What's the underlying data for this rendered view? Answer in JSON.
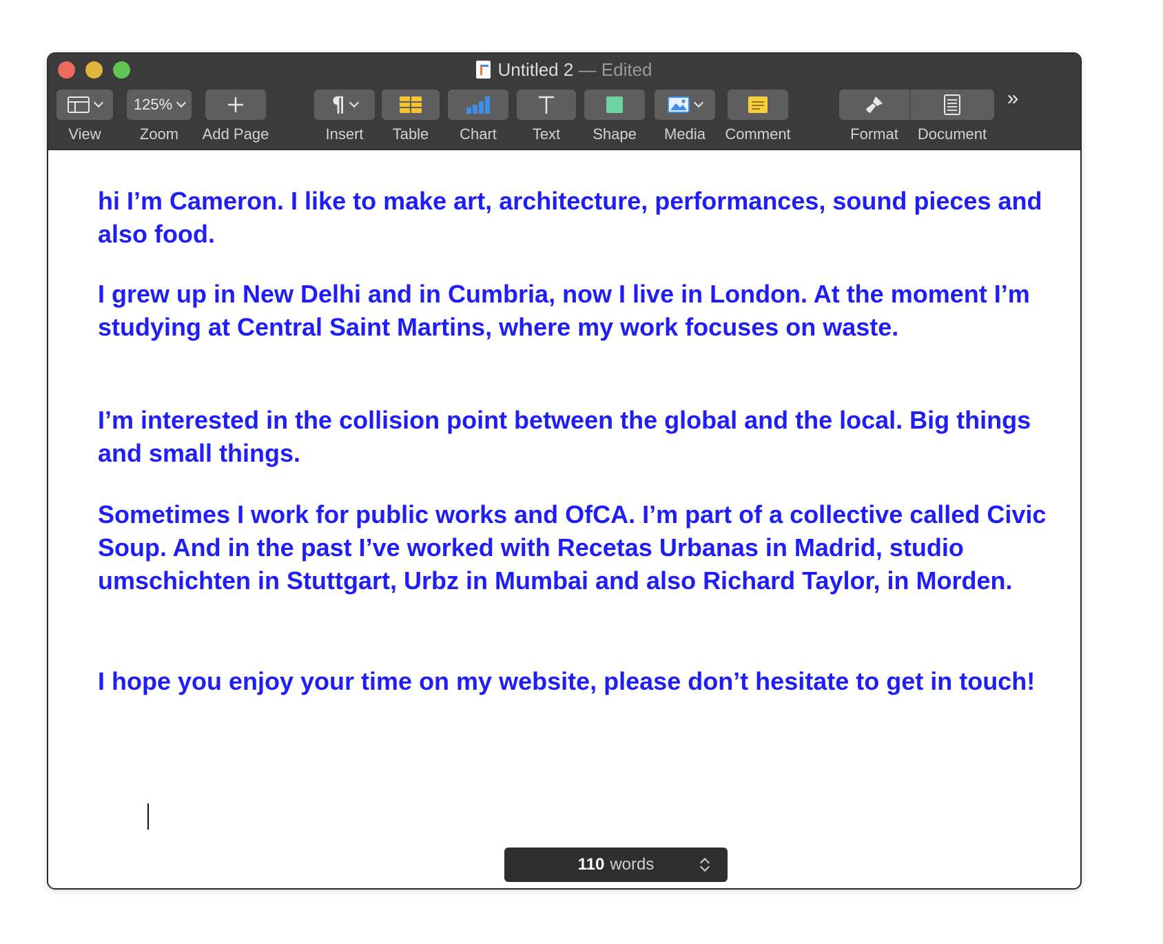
{
  "window": {
    "title": "Untitled 2",
    "title_status": "— Edited"
  },
  "toolbar": {
    "view_label": "View",
    "zoom_value": "125%",
    "zoom_label": "Zoom",
    "add_page_label": "Add Page",
    "insert_label": "Insert",
    "table_label": "Table",
    "chart_label": "Chart",
    "text_label": "Text",
    "shape_label": "Shape",
    "media_label": "Media",
    "comment_label": "Comment",
    "format_label": "Format",
    "document_label": "Document",
    "overflow_icon": "»"
  },
  "document": {
    "paragraphs": [
      "hi I’m Cameron. I like to make art, architecture, performances, sound pieces and also food.",
      "I grew up in New Delhi and in Cumbria, now I live in London. At the moment I’m studying at Central Saint Martins, where my work focuses on waste.",
      "I’m interested in the collision point between the global and the local. Big things and small things.",
      "Sometimes I work for public works and OfCA. I’m part of a collective called Civic Soup. And in the past I’ve worked with Recetas Urbanas in Madrid, studio umschichten in Stuttgart, Urbz in Mumbai and also Richard Taylor, in Morden.",
      "I hope you enjoy your time on my website, please don’t hesitate to get in touch!"
    ],
    "text_color": "#1f1ff5"
  },
  "statusbar": {
    "word_count": "110",
    "word_label": "words"
  },
  "colors": {
    "close": "#ec6a5e",
    "minimize": "#e0b43d",
    "maximize": "#61c454",
    "toolbar_bg": "#3b3b3b"
  }
}
